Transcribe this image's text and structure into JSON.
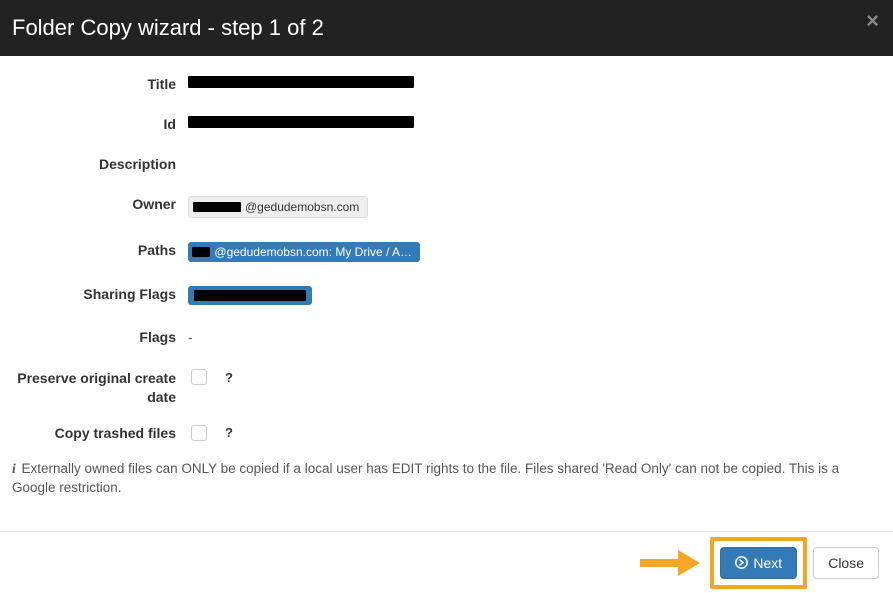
{
  "header": {
    "title": "Folder Copy wizard - step 1 of 2"
  },
  "fields": {
    "title_label": "Title",
    "id_label": "Id",
    "description_label": "Description",
    "description_value": "",
    "owner_label": "Owner",
    "owner_suffix": "@gedudemobsn.com",
    "paths_label": "Paths",
    "paths_suffix": "@gedudemobsn.com: My Drive / A…",
    "sharing_flags_label": "Sharing Flags",
    "flags_label": "Flags",
    "flags_value": "-",
    "preserve_label": "Preserve original create date",
    "copy_trashed_label": "Copy trashed files"
  },
  "info": {
    "text": "Externally owned files can ONLY be copied if a local user has EDIT rights to the file. Files shared 'Read Only' can not be copied. This is a Google restriction."
  },
  "footer": {
    "next_label": "Next",
    "close_label": "Close"
  }
}
